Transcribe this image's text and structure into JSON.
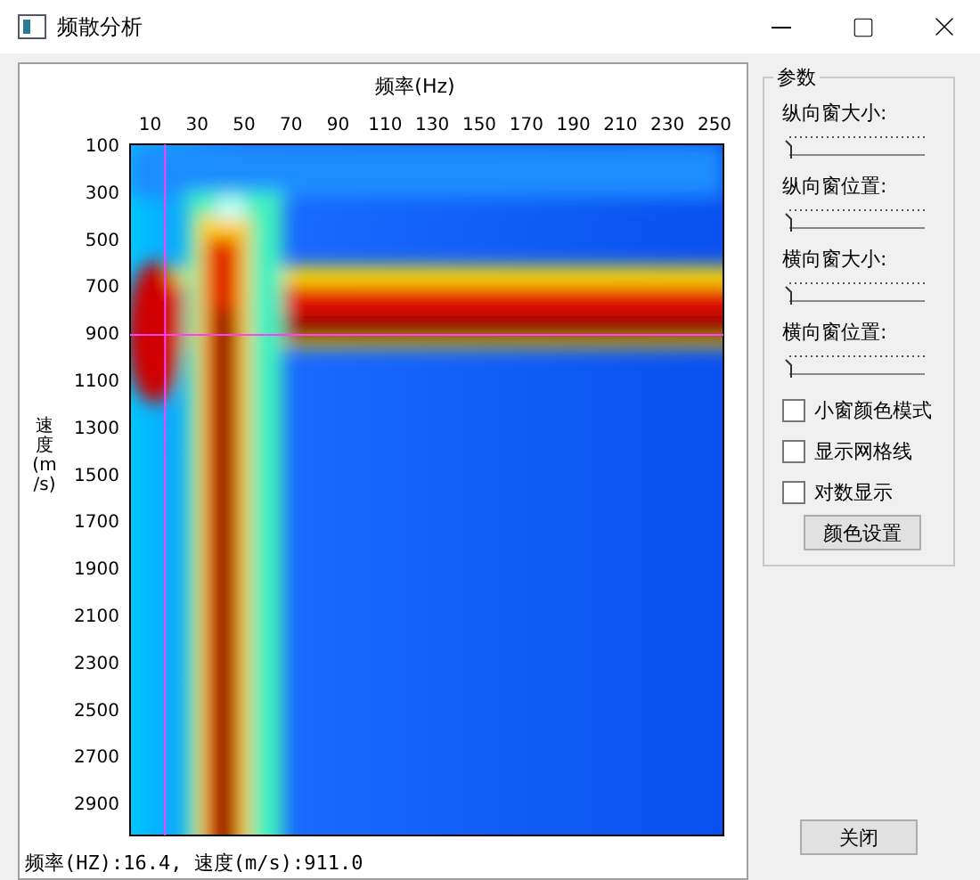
{
  "window": {
    "title": "频散分析"
  },
  "plot": {
    "x_axis_title": "频率(Hz)",
    "x_ticks": [
      "10",
      "30",
      "50",
      "70",
      "90",
      "110",
      "130",
      "150",
      "170",
      "190",
      "210",
      "230",
      "250"
    ],
    "y_axis_title": "速度(m/s)",
    "y_ticks": [
      "100",
      "300",
      "500",
      "700",
      "900",
      "1100",
      "1300",
      "1500",
      "1700",
      "1900",
      "2100",
      "2300",
      "2500",
      "2700",
      "2900"
    ],
    "readout": "频率(HZ):16.4, 速度(m/s):911.0"
  },
  "params": {
    "title": "参数",
    "sliders": [
      {
        "label": "纵向窗大小:",
        "level": 0
      },
      {
        "label": "纵向窗位置:",
        "level": 0
      },
      {
        "label": "横向窗大小:",
        "level": 0
      },
      {
        "label": "横向窗位置:",
        "level": 0
      }
    ],
    "checkboxes": [
      {
        "label": "小窗颜色模式",
        "checked": false
      },
      {
        "label": "显示网格线",
        "checked": false
      },
      {
        "label": "对数显示",
        "checked": false
      }
    ],
    "color_button": "颜色设置"
  },
  "close_button": "关闭"
}
